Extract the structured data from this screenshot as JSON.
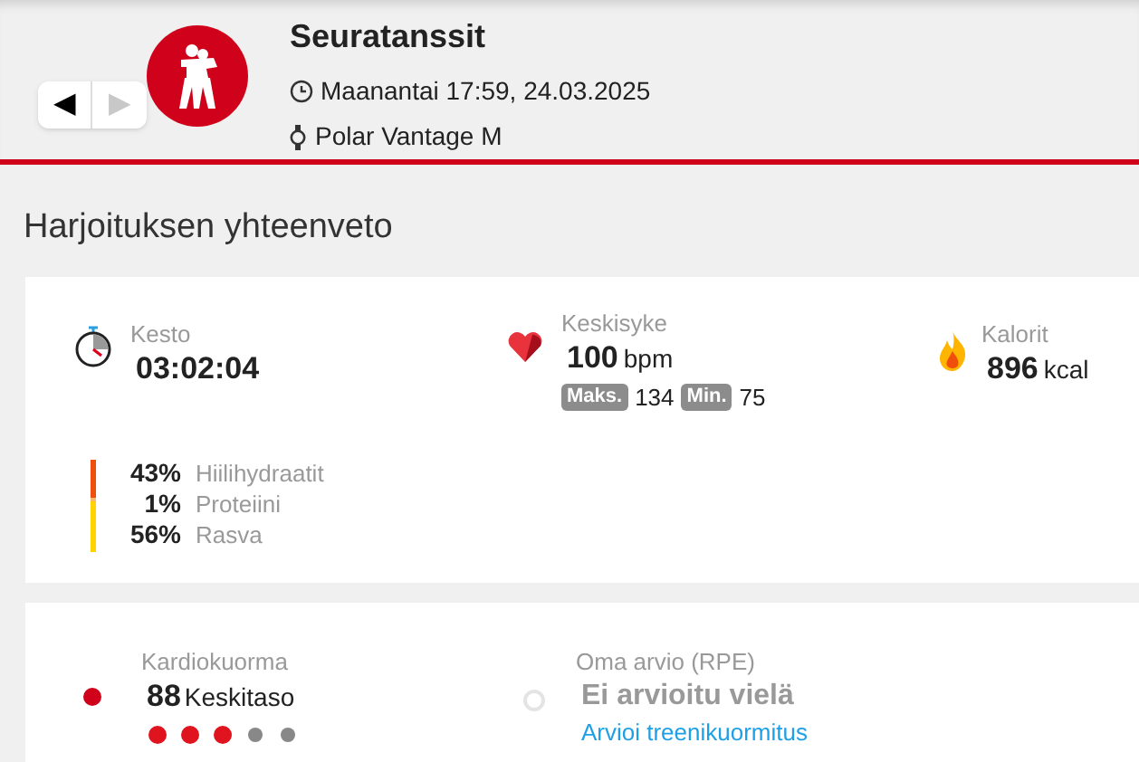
{
  "header": {
    "nav": [
      {
        "label": "◀",
        "disabled": false
      },
      {
        "label": "▶",
        "disabled": true
      }
    ],
    "title": "Seuratanssit",
    "datetime": "Maanantai 17:59, 24.03.2025",
    "device": "Polar Vantage M"
  },
  "section_title": "Harjoituksen yhteenveto",
  "summary": {
    "duration": {
      "label": "Kesto",
      "value": "03:02:04"
    },
    "heart_rate": {
      "label": "Keskisyke",
      "value": "100",
      "unit": "bpm",
      "max_label": "Maks.",
      "max": "134",
      "min_label": "Min.",
      "min": "75"
    },
    "calories": {
      "label": "Kalorit",
      "value": "896",
      "unit": "kcal"
    },
    "nutrition": [
      {
        "percent": "43%",
        "label": "Hiilihydraatit",
        "color": "#f04e0c"
      },
      {
        "percent": "1%",
        "label": "Proteiini",
        "color": "#f8b870"
      },
      {
        "percent": "56%",
        "label": "Rasva",
        "color": "#ffd200"
      }
    ]
  },
  "load": {
    "cardio": {
      "label": "Kardiokuorma",
      "value": "88",
      "level_text": "Keskitaso",
      "stars": 3
    },
    "rpe": {
      "label": "Oma arvio (RPE)",
      "value": "Ei arvioitu vielä",
      "link": "Arvioi treenikuormitus"
    }
  }
}
